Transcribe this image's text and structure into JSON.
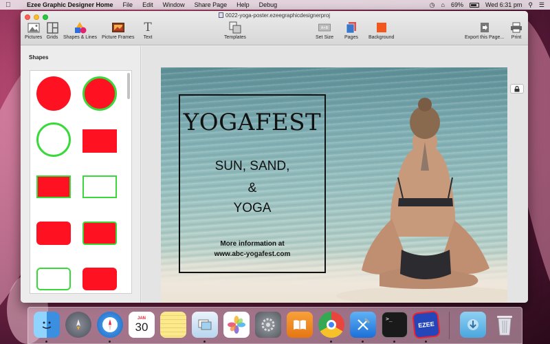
{
  "menubar": {
    "app_name": "Ezee Graphic Designer Home",
    "items": [
      "File",
      "Edit",
      "Window",
      "Share Page",
      "Help",
      "Debug"
    ],
    "battery": "69%",
    "clock": "Wed 6:31 pm"
  },
  "window": {
    "doc_title": "0022-yoga-poster.ezeegraphicdesignerproj"
  },
  "toolbar": {
    "pictures": "Pictures",
    "grids": "Grids",
    "shapes_lines": "Shapes & Lines",
    "picture_frames": "Picture Frames",
    "text": "Text",
    "templates": "Templates",
    "set_size": "Set Size",
    "pages": "Pages",
    "background": "Background",
    "export": "Export this Page...",
    "print": "Print"
  },
  "panel": {
    "title": "Shapes"
  },
  "poster": {
    "title": "YOGAFEST",
    "line1": "SUN, SAND,",
    "line2": "&",
    "line3": "YOGA",
    "info1": "More information at",
    "info2": "www.abc-yogafest.com"
  },
  "colors": {
    "shape_fill": "#fe1120",
    "shape_outline": "#39d93b",
    "background_swatch": "#f2581e"
  },
  "dock": {
    "apps": [
      "finder-icon",
      "launchpad-icon",
      "safari-icon",
      "calendar-icon",
      "notes-icon",
      "preview-icon",
      "photos-icon",
      "system-preferences-icon",
      "ibooks-icon",
      "chrome-icon",
      "xcode-icon",
      "terminal-icon",
      "ezee-icon",
      "downloads-icon",
      "trash-icon"
    ],
    "calendar_month": "JAN",
    "calendar_day": "30",
    "ezee_label": "EZEE"
  }
}
